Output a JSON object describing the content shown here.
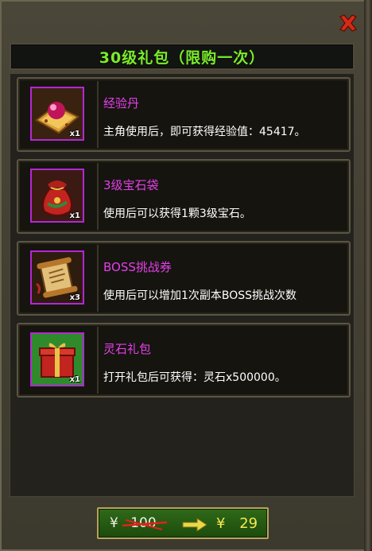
{
  "title": "30级礼包（限购一次）",
  "items": [
    {
      "name": "经验丹",
      "desc": "主角使用后，即可获得经验值：45417。",
      "qty": "x1",
      "icon": "pearl-on-tray-icon"
    },
    {
      "name": "3级宝石袋",
      "desc": "使用后可以获得1颗3级宝石。",
      "qty": "x1",
      "icon": "gem-bag-icon"
    },
    {
      "name": "BOSS挑战券",
      "desc": "使用后可以增加1次副本BOSS挑战次数",
      "qty": "x3",
      "icon": "scroll-icon"
    },
    {
      "name": "灵石礼包",
      "desc": "打开礼包后可获得：灵石x500000。",
      "qty": "x1",
      "icon": "gift-box-icon"
    }
  ],
  "price": {
    "currency": "¥",
    "original": "100",
    "current": "29"
  },
  "colors": {
    "title": "#7bec2a",
    "item_name": "#e53fe9",
    "icon_border": "#b427d6",
    "price_current": "#f6e84c"
  }
}
